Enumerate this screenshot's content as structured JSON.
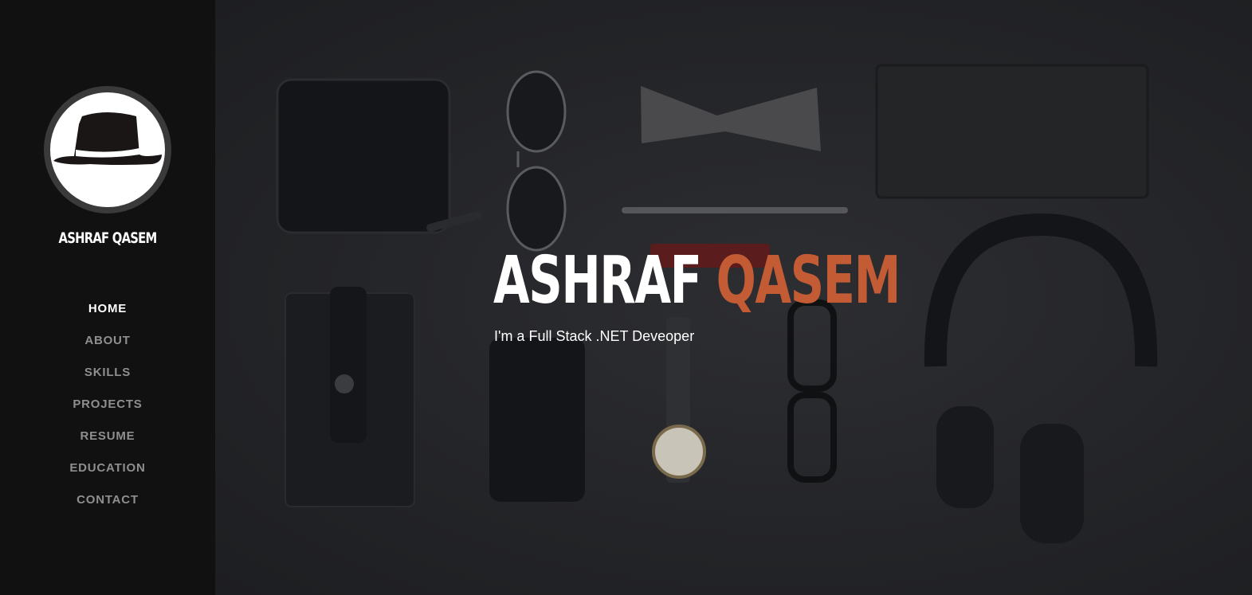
{
  "sidebar": {
    "logo": {
      "icon": "fedora-hat-icon"
    },
    "site_name": "ASHRAF QASEM",
    "nav": [
      {
        "label": "HOME",
        "active": true
      },
      {
        "label": "ABOUT",
        "active": false
      },
      {
        "label": "SKILLS",
        "active": false
      },
      {
        "label": "PROJECTS",
        "active": false
      },
      {
        "label": "RESUME",
        "active": false
      },
      {
        "label": "EDUCATION",
        "active": false
      },
      {
        "label": "CONTACT",
        "active": false
      }
    ]
  },
  "hero": {
    "first_name": "ASHRAF",
    "last_name": "QASEM",
    "subtitle": "I'm a Full Stack .NET Deveoper"
  },
  "colors": {
    "sidebar_bg": "#121111",
    "accent": "#c35b34",
    "nav_active": "#ffffff",
    "nav_inactive": "#8f8f8f"
  }
}
